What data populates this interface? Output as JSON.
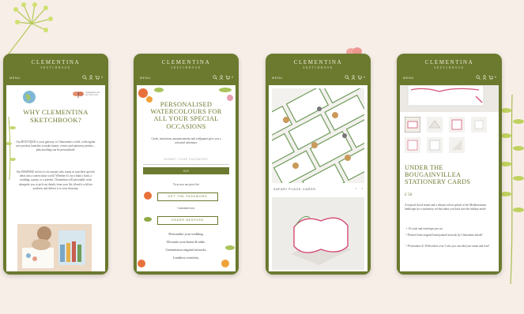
{
  "colors": {
    "background": "#f7eee8",
    "brand": "#6b7a2f"
  },
  "header": {
    "brand": "CLEMENTINA",
    "sub": "SKETCHBOOK",
    "menu": "MENU",
    "icons": [
      "search-icon",
      "user-icon",
      "cart-icon"
    ],
    "cart_count": "0"
  },
  "screen1": {
    "note": "handpainted with love since 2012",
    "title": "WHY CLEMENTINA SKETCHBOOK?",
    "para1": "Our BOUTIQUE is your gateway to Clementina's world, with regular new product launches to make homes, events and stationery prettier – plus anything can be personalised.",
    "para2": "Our BESPOKE service is for anyone who wants to turn their specific ideas into a watercolour world. Whether it's for a baby's birth, a wedding, a party, or a present, Clementina will personally work alongside you to pick out details from your life, blend it with her aesthetic and deliver it to your doorstep."
  },
  "screen2": {
    "title": "PERSONALISED WATERCOLOURS FOR ALL YOUR SPECIAL OCCASIONS",
    "intro": "Cards, invitations, announcements and wallpapers give you a colourful adventure.",
    "password_placeholder": "SUBMIT YOUR PASSWORD",
    "go": "GO",
    "access_label": "To access our price list",
    "get_password": "GET THE PASSWORD",
    "customise_label": "Customise now",
    "order_bespoke": "ORDER BESPOKE",
    "list": [
      "Personalise your wedding.",
      "Decorate your home & table.",
      "Commission original artworks.",
      "Limitless creativity."
    ]
  },
  "screen3": {
    "product": "SAFARI PLACE CARDS"
  },
  "screen4": {
    "title": "UNDER THE BOUGAINVILLEA STATIONERY CARDS",
    "price": "£ 50",
    "desc": "A tropical floral frame and a vibrant colour splash of the Mediterranean landscape for a stationery set that takes you back into the holiday mode.",
    "bullets": [
      "10 cards and envelopes per set",
      "Printed from original hand painted artwork by Clementina herself",
      "Personalise it! With orders over 3 sets you can add your name and font!"
    ]
  }
}
